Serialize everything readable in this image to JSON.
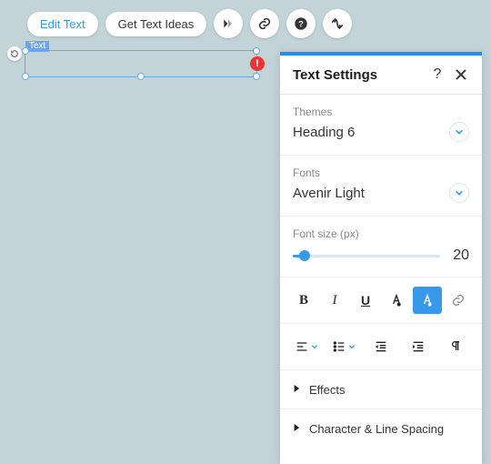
{
  "toolbar": {
    "edit_text": "Edit Text",
    "get_text_ideas": "Get Text Ideas"
  },
  "canvas": {
    "selection_label": "Text",
    "error_glyph": "!"
  },
  "panel": {
    "title": "Text Settings",
    "help_glyph": "?",
    "themes": {
      "label": "Themes",
      "value": "Heading 6"
    },
    "fonts": {
      "label": "Fonts",
      "value": "Avenir Light"
    },
    "fontsize": {
      "label": "Font size (px)",
      "value": "20"
    },
    "expanders": {
      "effects": "Effects",
      "spacing": "Character & Line Spacing"
    }
  }
}
